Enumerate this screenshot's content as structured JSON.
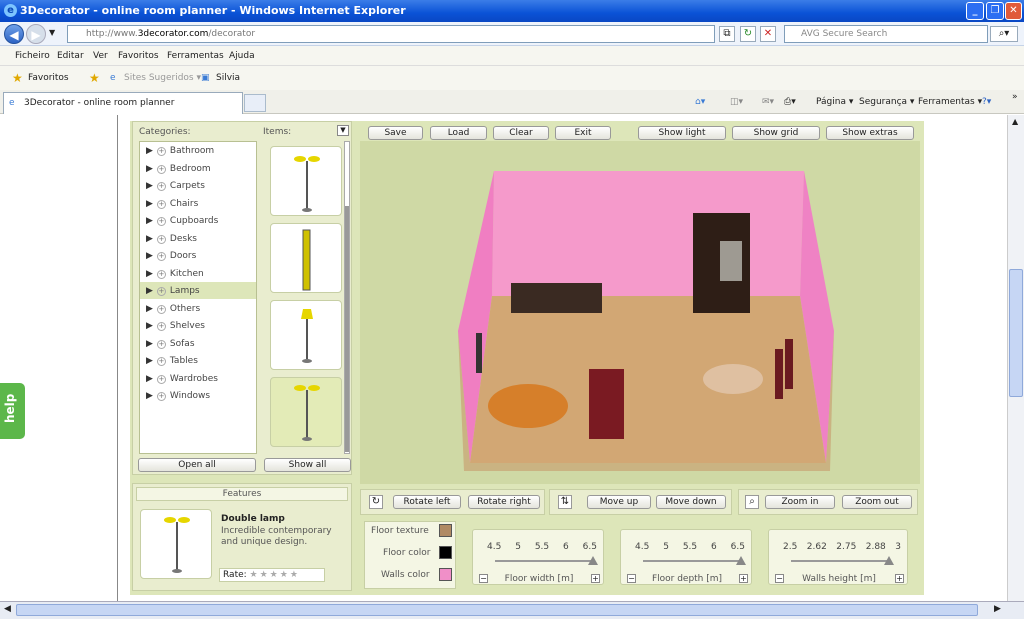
{
  "window": {
    "title": "3Decorator - online room planner - Windows Internet Explorer"
  },
  "address": {
    "prefix": "http://www.",
    "host": "3decorator.com",
    "path": "/decorator",
    "search_placeholder": "AVG Secure Search"
  },
  "menu": [
    "Ficheiro",
    "Editar",
    "Ver",
    "Favoritos",
    "Ferramentas",
    "Ajuda"
  ],
  "favbar": {
    "favoritos": "Favoritos",
    "suggested": "Sites Sugeridos ▾",
    "silvia": "Silvia"
  },
  "tab": {
    "title": "3Decorator - online room planner",
    "pagina": "Página ▾",
    "seguranca": "Segurança ▾",
    "ferramentas": "Ferramentas ▾"
  },
  "help": "help",
  "sidebar": {
    "categories_label": "Categories:",
    "items_label": "Items:",
    "open_all": "Open all",
    "show_all": "Show all",
    "categories": [
      "Bathroom",
      "Bedroom",
      "Carpets",
      "Chairs",
      "Cupboards",
      "Desks",
      "Doors",
      "Kitchen",
      "Lamps",
      "Others",
      "Shelves",
      "Sofas",
      "Tables",
      "Wardrobes",
      "Windows"
    ],
    "selected": "Lamps"
  },
  "toolbar": {
    "save": "Save",
    "load": "Load",
    "clear": "Clear",
    "exit": "Exit",
    "show_light": "Show light",
    "show_grid": "Show grid",
    "show_extras": "Show extras"
  },
  "features": {
    "header": "Features",
    "name": "Double lamp",
    "description": "Incredible contemporary and unique design.",
    "rate_label": "Rate:",
    "stars": "★★★★★"
  },
  "controls": {
    "rotate_left": "Rotate left",
    "rotate_right": "Rotate right",
    "move_up": "Move up",
    "move_down": "Move down",
    "zoom_in": "Zoom in",
    "zoom_out": "Zoom out"
  },
  "colors": {
    "floor_texture_label": "Floor texture",
    "floor_color_label": "Floor color",
    "walls_color_label": "Walls color",
    "floor_texture": "#b08a64",
    "floor_color": "#000000",
    "walls_color": "#f08fc8"
  },
  "sliders": [
    {
      "label": "Floor width [m]",
      "ticks": [
        "4.5",
        "5",
        "5.5",
        "6",
        "6.5"
      ],
      "value": 6.5,
      "min": 4.5,
      "max": 6.5
    },
    {
      "label": "Floor depth [m]",
      "ticks": [
        "4.5",
        "5",
        "5.5",
        "6",
        "6.5"
      ],
      "value": 6.5,
      "min": 4.5,
      "max": 6.5
    },
    {
      "label": "Walls height [m]",
      "ticks": [
        "2.5",
        "2.62",
        "2.75",
        "2.88",
        "3"
      ],
      "value": 3,
      "min": 2.5,
      "max": 3
    }
  ]
}
